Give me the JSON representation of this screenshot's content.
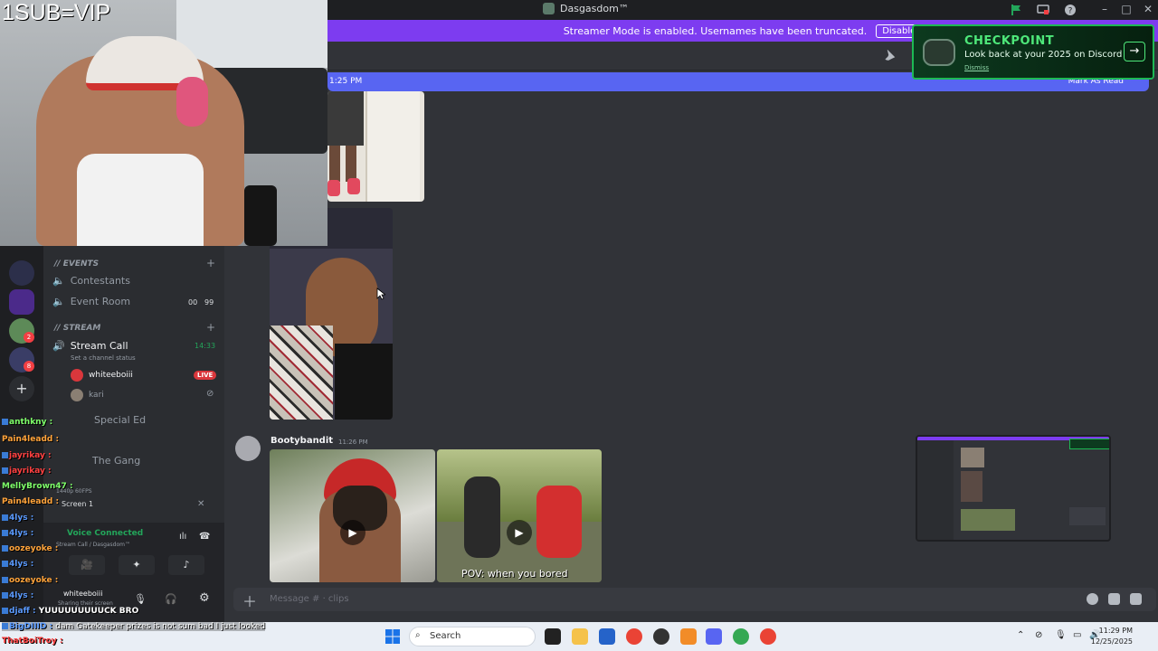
{
  "window": {
    "title": "Dasgasdom™",
    "controls": [
      "minimize-icon",
      "maximize-icon",
      "close-icon"
    ]
  },
  "streamer_banner": {
    "text": "Streamer Mode is enabled. Usernames have been truncated.",
    "button": "Disable"
  },
  "new_messages_bar": {
    "time": "1:25 PM",
    "action": "Mark As Read"
  },
  "checkpoint": {
    "title": "CHECKPOINT",
    "subtitle": "Look back at your 2025 on Discord",
    "dismiss": "Dismiss"
  },
  "webcam": {
    "overlay_text": "1SUB=VIP"
  },
  "servers": {
    "badges": [
      "2",
      "8"
    ]
  },
  "channels": {
    "events_category": "// Events",
    "event_channels": [
      {
        "name": "Contestants"
      },
      {
        "name": "Event Room",
        "count_a": "00",
        "count_b": "99"
      }
    ],
    "stream_category": "// STREAM",
    "stream_call": {
      "name": "Stream Call",
      "timer": "14:33",
      "status": "Set a channel status"
    },
    "voice_users": [
      {
        "name": "whiteeboiii",
        "badge": "LIVE"
      },
      {
        "name": "kari"
      }
    ],
    "other_channels": [
      "Special Ed",
      "The Gang"
    ]
  },
  "voice_panel": {
    "status": "Voice Connected",
    "channel": "Stream Call / Dasgasdom™",
    "stream_quality": "1440p 60FPS",
    "screen_label": "Screen 1",
    "user": "whiteeboiii",
    "user_status": "Sharing their screen"
  },
  "stream_chat": [
    {
      "user": "anthkny",
      "msg": "",
      "color": "#7fff6a"
    },
    {
      "user": "Pain4leadd",
      "msg": "",
      "color": "#ffa33a"
    },
    {
      "user": "jayrikay",
      "msg": "",
      "color": "#ff4040"
    },
    {
      "user": "jayrikay",
      "msg": "",
      "color": "#ff4040"
    },
    {
      "user": "MellyBrown47",
      "msg": "",
      "color": "#7fff6a"
    },
    {
      "user": "Pain4leadd",
      "msg": "",
      "color": "#ffa33a"
    },
    {
      "user": "4lys",
      "msg": "",
      "color": "#5b9bff"
    },
    {
      "user": "4lys",
      "msg": "",
      "color": "#5b9bff"
    },
    {
      "user": "oozeyoke",
      "msg": "",
      "color": "#ffa33a"
    },
    {
      "user": "4lys",
      "msg": "",
      "color": "#5b9bff"
    },
    {
      "user": "oozeyoke",
      "msg": "",
      "color": "#ffa33a"
    },
    {
      "user": "4lys",
      "msg": "",
      "color": "#5b9bff"
    },
    {
      "user": "djaff",
      "msg": "YUUUUUUUUUCK BRO",
      "color": "#5b9bff"
    },
    {
      "user": "BigDIIID",
      "msg": "dam Gatekeeper prizes is not sum bad I just looked",
      "color": "#5b9bff"
    },
    {
      "user": "ThatBoiTroy",
      "msg": "",
      "color": "#ff4040"
    }
  ],
  "message": {
    "author": "Bootybandit",
    "time": "11:26 PM",
    "video_caption": "POV: when you bored"
  },
  "composer": {
    "placeholder": "Message # · clips"
  },
  "taskbar": {
    "search": "Search",
    "time": "11:29 PM",
    "date": "12/25/2025"
  }
}
